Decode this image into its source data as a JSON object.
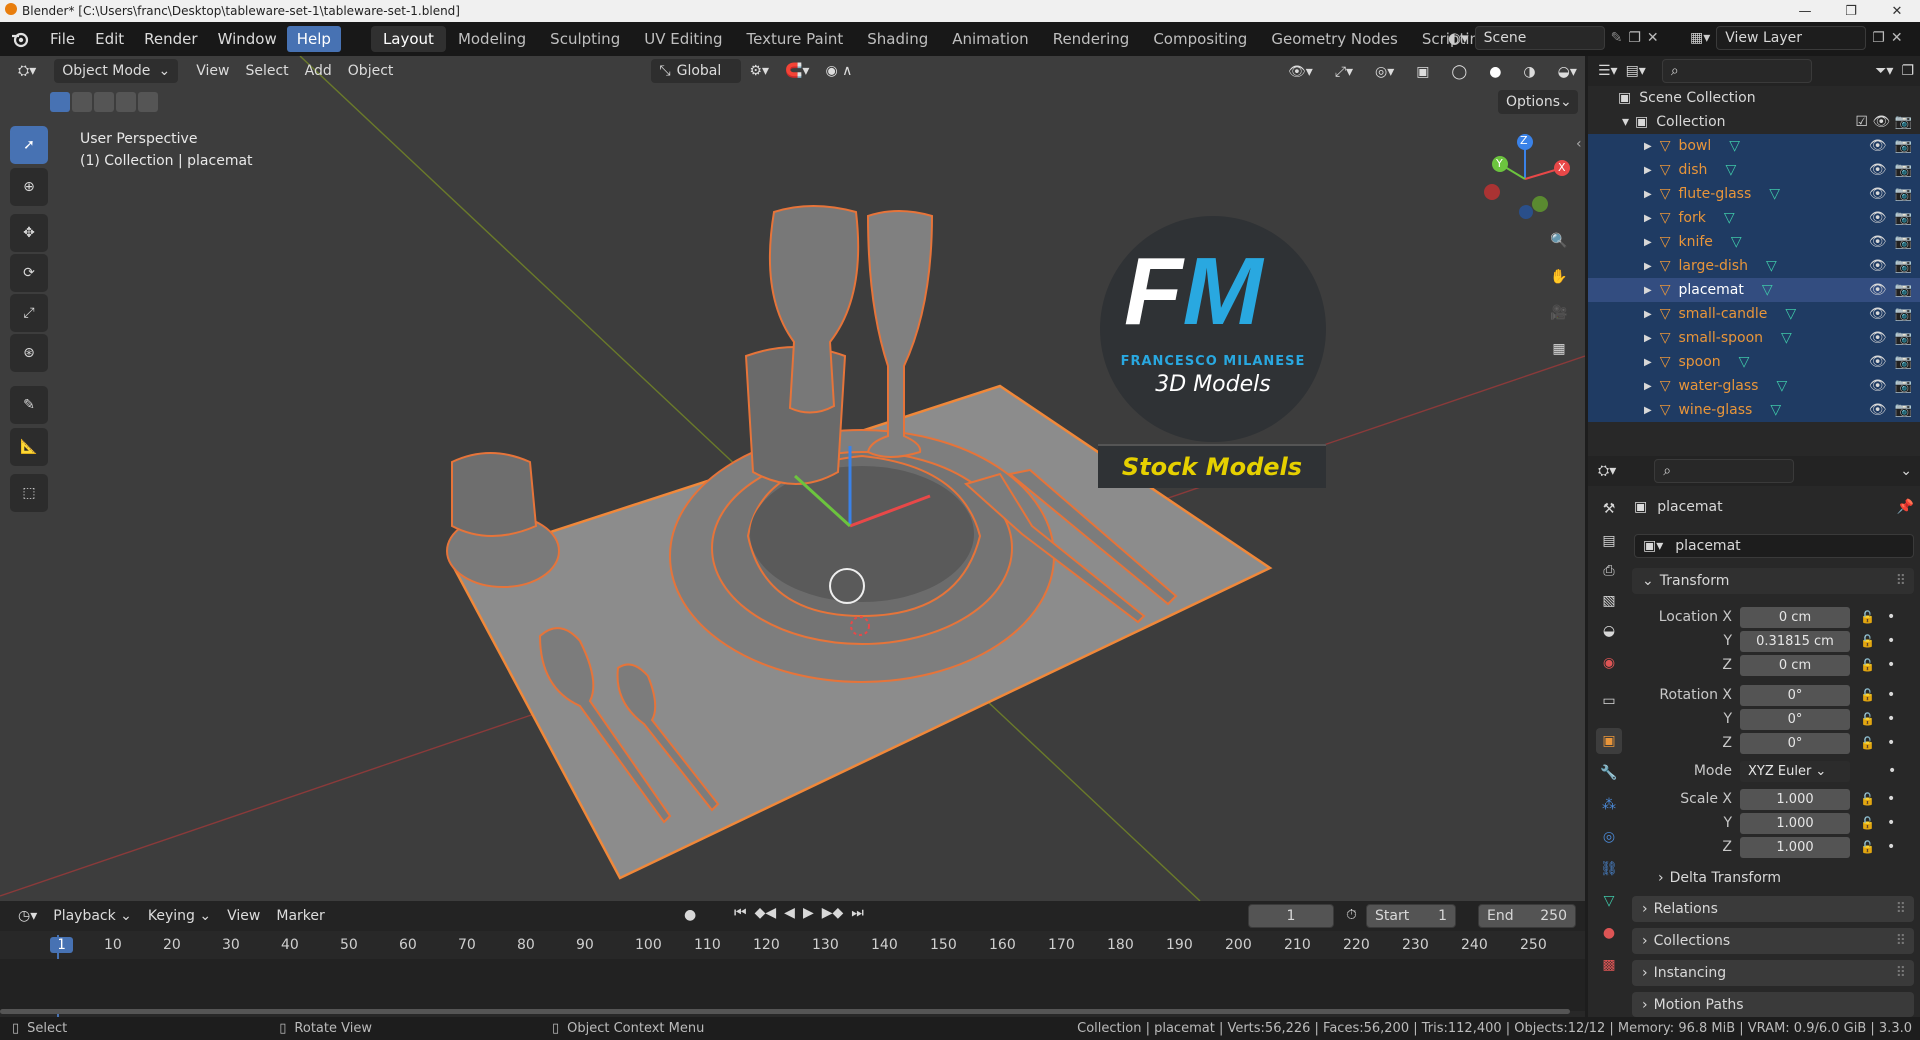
{
  "window": {
    "title": "Blender* [C:\\Users\\franc\\Desktop\\tableware-set-1\\tableware-set-1.blend]",
    "controls": [
      "—",
      "❐",
      "✕"
    ]
  },
  "menu": [
    "File",
    "Edit",
    "Render",
    "Window",
    "Help"
  ],
  "workspaces": [
    "Layout",
    "Modeling",
    "Sculpting",
    "UV Editing",
    "Texture Paint",
    "Shading",
    "Animation",
    "Rendering",
    "Compositing",
    "Geometry Nodes",
    "Scripting"
  ],
  "add_workspace": "+",
  "scene": {
    "label": "Scene"
  },
  "view_layer": {
    "label": "View Layer"
  },
  "viewport": {
    "mode": "Object Mode",
    "menus": [
      "View",
      "Select",
      "Add",
      "Object"
    ],
    "transform_orientation": "Global",
    "options": "Options",
    "overlay_line1": "User Perspective",
    "overlay_line2": "(1) Collection | placemat",
    "gizmo_axes": {
      "x": "X",
      "y": "Y",
      "z": "Z"
    }
  },
  "logo": {
    "initials_f": "F",
    "initials_m": "M",
    "name": "FRANCESCO MILANESE",
    "tagline": "3D Models",
    "banner": "Stock Models"
  },
  "outliner": {
    "scene_collection": "Scene Collection",
    "collection": "Collection",
    "objects": [
      "bowl",
      "dish",
      "flute-glass",
      "fork",
      "knife",
      "large-dish",
      "placemat",
      "small-candle",
      "small-spoon",
      "spoon",
      "water-glass",
      "wine-glass"
    ],
    "active": "placemat"
  },
  "properties": {
    "object_name": "placemat",
    "data_name": "placemat",
    "transform_title": "Transform",
    "location": {
      "label": "Location X",
      "x": "0 cm",
      "y": "0.31815 cm",
      "z": "0 cm"
    },
    "rotation": {
      "label": "Rotation X",
      "x": "0°",
      "y": "0°",
      "z": "0°"
    },
    "mode": {
      "label": "Mode",
      "value": "XYZ Euler"
    },
    "scale": {
      "label": "Scale X",
      "x": "1.000",
      "y": "1.000",
      "z": "1.000"
    },
    "axis_y": "Y",
    "axis_z": "Z",
    "sections": [
      "Delta Transform",
      "Relations",
      "Collections",
      "Instancing",
      "Motion Paths"
    ]
  },
  "timeline": {
    "menus": [
      "Playback",
      "Keying",
      "View",
      "Marker"
    ],
    "current_frame": "1",
    "start_label": "Start",
    "start": "1",
    "end_label": "End",
    "end": "250",
    "ruler": [
      "1",
      "10",
      "20",
      "30",
      "40",
      "50",
      "60",
      "70",
      "80",
      "90",
      "100",
      "110",
      "120",
      "130",
      "140",
      "150",
      "160",
      "170",
      "180",
      "190",
      "200",
      "210",
      "220",
      "230",
      "240",
      "250"
    ]
  },
  "status": {
    "select": "Select",
    "rotate": "Rotate View",
    "context": "Object Context Menu",
    "stats": "Collection | placemat | Verts:56,226 | Faces:56,200 | Tris:112,400 | Objects:12/12 | Memory: 96.8 MiB | VRAM: 0.9/6.0 GiB | 3.3.0"
  },
  "colors": {
    "accent": "#4772b3",
    "selection_outline": "#f0883a",
    "logo_blue": "#29a8e0",
    "banner_text": "#e6d000",
    "object_icon": "#e8953a",
    "mesh_icon": "#3fc7a8"
  }
}
